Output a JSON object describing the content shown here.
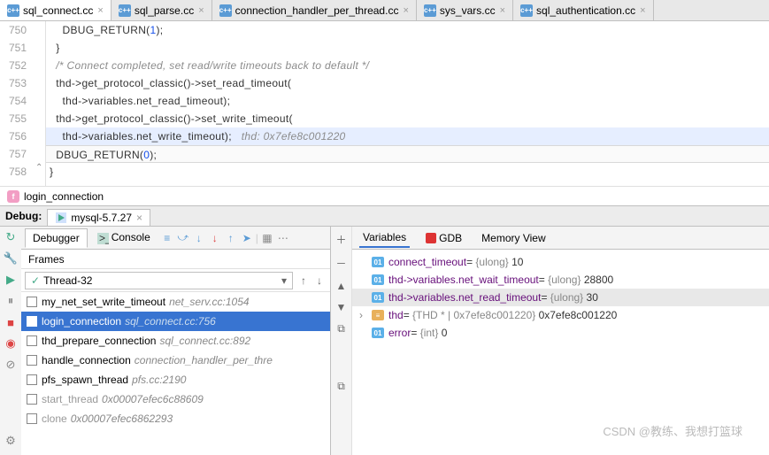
{
  "tabs": [
    {
      "label": "sql_connect.cc",
      "active": true
    },
    {
      "label": "sql_parse.cc",
      "active": false
    },
    {
      "label": "connection_handler_per_thread.cc",
      "active": false
    },
    {
      "label": "sys_vars.cc",
      "active": false
    },
    {
      "label": "sql_authentication.cc",
      "active": false
    }
  ],
  "code": {
    "lines": [
      {
        "n": "750",
        "html": "    DBUG_RETURN(<span class='num'>1</span>);"
      },
      {
        "n": "751",
        "html": "  }"
      },
      {
        "n": "752",
        "html": "  <span class='cmt'>/* Connect completed, set read/write timeouts back to default */</span>"
      },
      {
        "n": "753",
        "html": "  thd-&gt;get_protocol_classic()-&gt;set_read_timeout("
      },
      {
        "n": "754",
        "html": "    thd-&gt;variables.net_read_timeout);"
      },
      {
        "n": "755",
        "html": "  thd-&gt;get_protocol_classic()-&gt;set_write_timeout("
      },
      {
        "n": "756",
        "html": "    thd-&gt;variables.net_write_timeout);   <span class='inl'>thd: 0x7efe8c001220</span>",
        "hl": true
      },
      {
        "n": "757",
        "html": "  DBUG_RETURN(<span class='num'>0</span>);",
        "cur": true
      },
      {
        "n": "758",
        "html": "}"
      }
    ]
  },
  "breadcrumb": {
    "fn": "login_connection",
    "badge": "f"
  },
  "debug": {
    "label": "Debug:",
    "session": "mysql-5.7.27",
    "innerTabs": {
      "debugger": "Debugger",
      "console": "Console"
    },
    "framesHeader": "Frames",
    "thread": "Thread-32",
    "frames": [
      {
        "fn": "my_net_set_write_timeout",
        "loc": "net_serv.cc:1054"
      },
      {
        "fn": "login_connection",
        "loc": "sql_connect.cc:756",
        "sel": true
      },
      {
        "fn": "thd_prepare_connection",
        "loc": "sql_connect.cc:892"
      },
      {
        "fn": "handle_connection",
        "loc": "connection_handler_per_thre"
      },
      {
        "fn": "pfs_spawn_thread",
        "loc": "pfs.cc:2190"
      },
      {
        "fn": "start_thread",
        "loc": "0x00007efec6c88609",
        "dim": true
      },
      {
        "fn": "clone",
        "loc": "0x00007efec6862293",
        "dim": true
      }
    ],
    "varTabs": {
      "variables": "Variables",
      "gdb": "GDB",
      "memory": "Memory View"
    },
    "vars": [
      {
        "name": "connect_timeout",
        "type": "{ulong}",
        "val": "10",
        "icon": "01"
      },
      {
        "name": "thd->variables.net_wait_timeout",
        "type": "{ulong}",
        "val": "28800",
        "icon": "01"
      },
      {
        "name": "thd->variables.net_read_timeout",
        "type": "{ulong}",
        "val": "30",
        "icon": "01",
        "sel": true
      },
      {
        "name": "thd",
        "type": "{THD * | 0x7efe8c001220}",
        "val": "0x7efe8c001220",
        "icon": "y",
        "exp": true
      },
      {
        "name": "error",
        "type": "{int}",
        "val": "0",
        "icon": "01"
      }
    ]
  },
  "watermark": "CSDN @教练、我想打篮球"
}
